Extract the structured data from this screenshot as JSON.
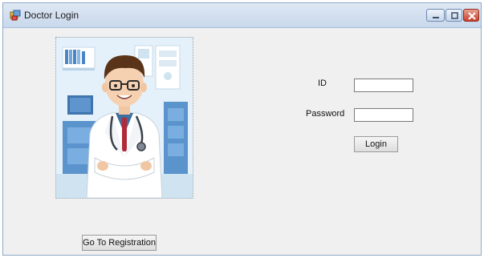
{
  "window": {
    "title": "Doctor Login",
    "icons": {
      "app": "app-icon",
      "minimize": "minimize-icon",
      "maximize": "maximize-icon",
      "close": "close-icon"
    }
  },
  "form": {
    "illustration": "doctor-illustration",
    "id_label": "ID",
    "id_value": "",
    "password_label": "Password",
    "password_value": "",
    "login_label": "Login",
    "registration_label": "Go To Registration"
  },
  "colors": {
    "titlebar": "#c9d8ec",
    "background": "#f0f0f0",
    "close_button": "#c7402c"
  }
}
